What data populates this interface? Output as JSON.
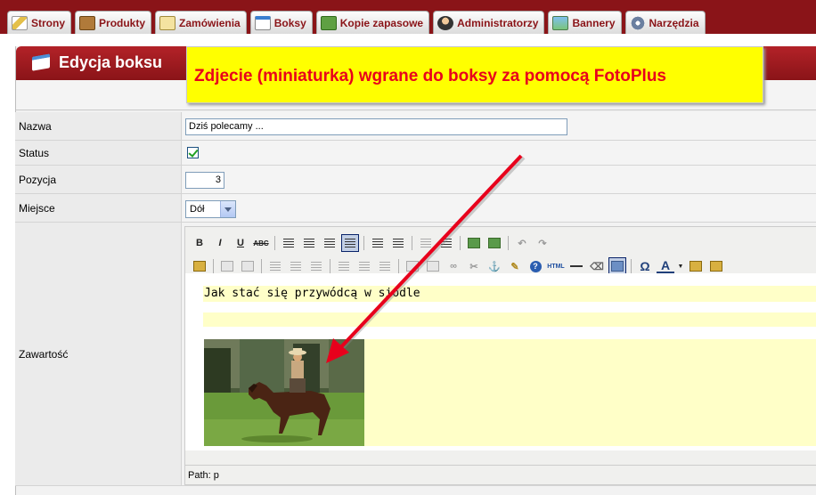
{
  "tabs": [
    {
      "label": "Strony",
      "icon": "pencil-icon"
    },
    {
      "label": "Produkty",
      "icon": "box-icon"
    },
    {
      "label": "Zamówienia",
      "icon": "scroll-icon"
    },
    {
      "label": "Boksy",
      "icon": "document-icon"
    },
    {
      "label": "Kopie zapasowe",
      "icon": "backup-icon"
    },
    {
      "label": "Administratorzy",
      "icon": "admin-icon"
    },
    {
      "label": "Bannery",
      "icon": "banner-icon"
    },
    {
      "label": "Narzędzia",
      "icon": "gears-icon"
    }
  ],
  "panel": {
    "title": "Edycja boksu"
  },
  "callout": {
    "text": "Zdjecie (miniaturka)  wgrane do boksy za pomocą FotoPlus"
  },
  "form": {
    "name_label": "Nazwa",
    "name_value": "Dziś polecamy ...",
    "status_label": "Status",
    "status_checked": true,
    "position_label": "Pozycja",
    "position_value": "3",
    "place_label": "Miejsce",
    "place_value": "Dół",
    "content_label": "Zawartość"
  },
  "editor": {
    "content_text": "Jak stać się przywódcą w siodle",
    "path": "Path: p",
    "toolbar_row1": [
      "B",
      "I",
      "U",
      "ABC"
    ],
    "toolbar_row2_labels": [
      "HTML",
      "Ω",
      "A"
    ]
  },
  "colors": {
    "brand_red": "#8a1418",
    "callout_bg": "#ffff00",
    "callout_text": "#e8001c",
    "arrow": "#e8001c",
    "highlight": "#ffffc8"
  }
}
